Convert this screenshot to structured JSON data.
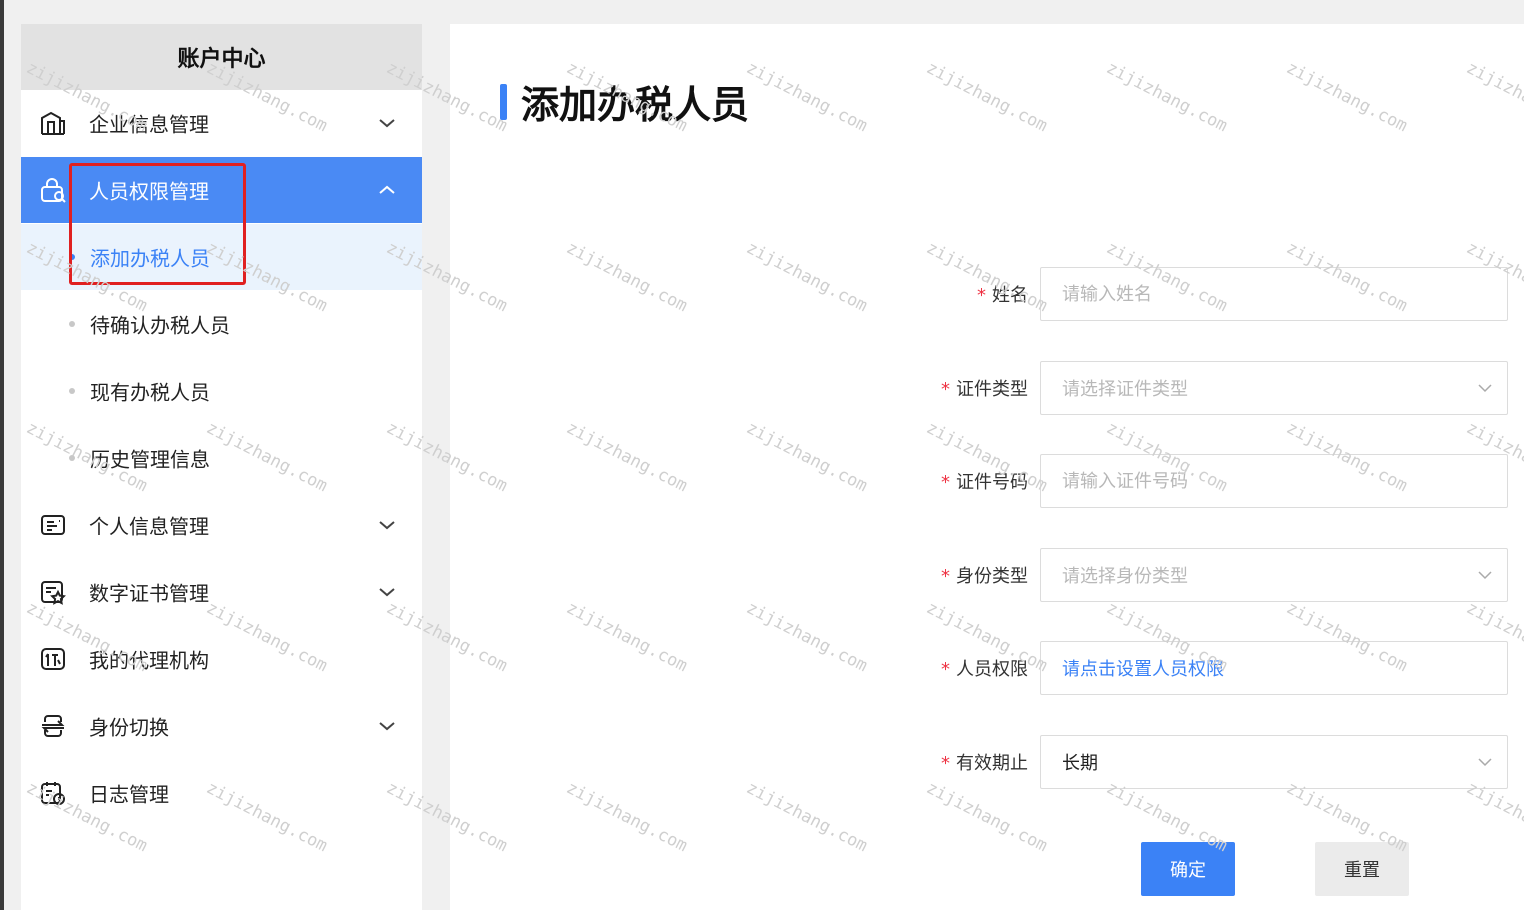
{
  "sidebar": {
    "header": "账户中心",
    "menu": [
      {
        "label": "企业信息管理",
        "icon": "building-icon",
        "expanded": false
      },
      {
        "label": "人员权限管理",
        "icon": "user-lock-icon",
        "expanded": true
      },
      {
        "label": "个人信息管理",
        "icon": "id-card-icon",
        "expanded": false
      },
      {
        "label": "数字证书管理",
        "icon": "certificate-icon",
        "expanded": false
      },
      {
        "label": "我的代理机构",
        "icon": "agency-icon",
        "expanded": false
      },
      {
        "label": "身份切换",
        "icon": "switch-icon",
        "expanded": false
      },
      {
        "label": "日志管理",
        "icon": "log-icon",
        "expanded": false
      }
    ],
    "submenu": [
      {
        "label": "添加办税人员",
        "selected": true
      },
      {
        "label": "待确认办税人员",
        "selected": false
      },
      {
        "label": "现有办税人员",
        "selected": false
      },
      {
        "label": "历史管理信息",
        "selected": false
      }
    ]
  },
  "main": {
    "title": "添加办税人员",
    "form": {
      "name": {
        "label": "姓名",
        "placeholder": "请输入姓名"
      },
      "id_type": {
        "label": "证件类型",
        "placeholder": "请选择证件类型"
      },
      "id_number": {
        "label": "证件号码",
        "placeholder": "请输入证件号码"
      },
      "identity_type": {
        "label": "身份类型",
        "placeholder": "请选择身份类型"
      },
      "permission": {
        "label": "人员权限",
        "link": "请点击设置人员权限"
      },
      "validity": {
        "label": "有效期止",
        "value": "长期"
      },
      "required_mark": "*"
    },
    "buttons": {
      "confirm": "确定",
      "reset": "重置"
    }
  },
  "watermark": "zijizhang.com",
  "colors": {
    "accent": "#4a8af4",
    "link": "#3b82f6",
    "required": "#e34",
    "highlight": "#e02020"
  }
}
